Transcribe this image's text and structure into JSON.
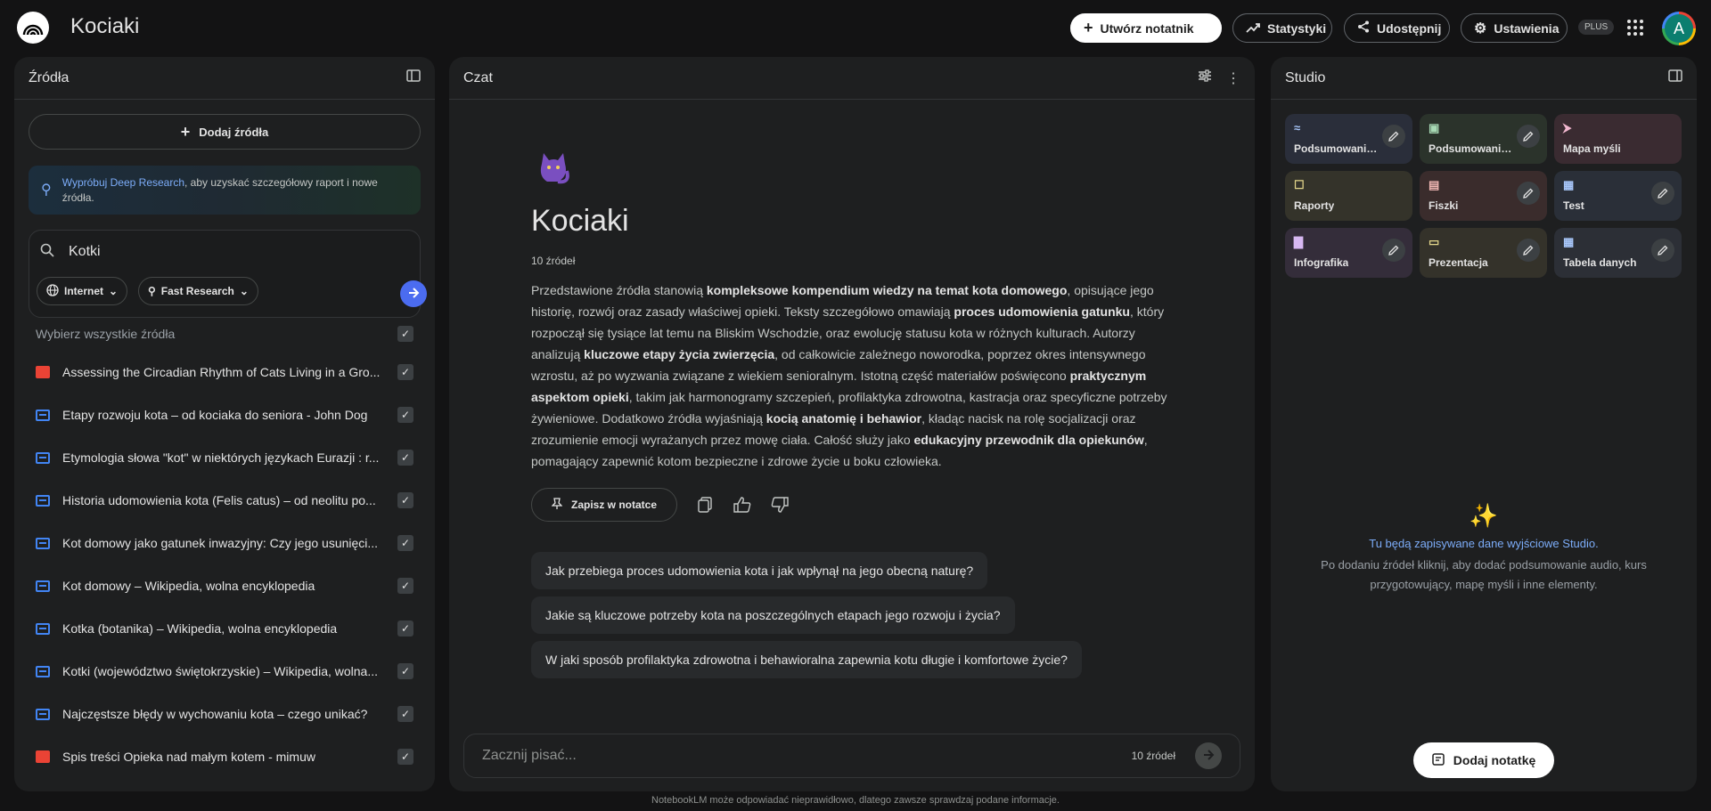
{
  "app": {
    "title": "Kociaki"
  },
  "topbar": {
    "create_notebook": "Utwórz notatnik",
    "statistics": "Statystyki",
    "share": "Udostępnij",
    "settings": "Ustawienia",
    "plan_badge": "PLUS",
    "avatar_letter": "A"
  },
  "sources": {
    "header": "Źródła",
    "add_label": "Dodaj źródła",
    "deep_research": {
      "link": "Wypróbuj Deep Research",
      "text": ", aby uzyskać szczegółowy raport i nowe źródła."
    },
    "search": {
      "value": "Kotki",
      "scope": "Internet",
      "mode": "Fast Research"
    },
    "select_all": "Wybierz wszystkie źródła",
    "items": [
      {
        "type": "pdf",
        "label": "Assessing the Circadian Rhythm of Cats Living in a Gro..."
      },
      {
        "type": "web",
        "label": "Etapy rozwoju kota – od kociaka do seniora - John Dog"
      },
      {
        "type": "web",
        "label": "Etymologia słowa \"kot\" w niektórych językach Eurazji : r..."
      },
      {
        "type": "web",
        "label": "Historia udomowienia kota (Felis catus) – od neolitu po..."
      },
      {
        "type": "web",
        "label": "Kot domowy jako gatunek inwazyjny: Czy jego usunięci..."
      },
      {
        "type": "web",
        "label": "Kot domowy – Wikipedia, wolna encyklopedia"
      },
      {
        "type": "web",
        "label": "Kotka (botanika) – Wikipedia, wolna encyklopedia"
      },
      {
        "type": "web",
        "label": "Kotki (województwo świętokrzyskie) – Wikipedia, wolna..."
      },
      {
        "type": "web",
        "label": "Najczęstsze błędy w wychowaniu kota – czego unikać?"
      },
      {
        "type": "pdf",
        "label": "Spis treści Opieka nad małym kotem - mimuw"
      }
    ]
  },
  "chat": {
    "header": "Czat",
    "notebook_title": "Kociaki",
    "source_count": "10 źródeł",
    "summary_parts": [
      [
        "",
        "Przedstawione źródła stanowią "
      ],
      [
        "b",
        "kompleksowe kompendium wiedzy na temat kota domowego"
      ],
      [
        "",
        ", opisujące jego historię, rozwój oraz zasady właściwej opieki. Teksty szczegółowo omawiają "
      ],
      [
        "b",
        "proces udomowienia gatunku"
      ],
      [
        "",
        ", który rozpoczął się tysiące lat temu na Bliskim Wschodzie, oraz ewolucję statusu kota w różnych kulturach. Autorzy analizują "
      ],
      [
        "b",
        "kluczowe etapy życia zwierzęcia"
      ],
      [
        "",
        ", od całkowicie zależnego noworodka, poprzez okres intensywnego wzrostu, aż po wyzwania związane z wiekiem senioralnym. Istotną część materiałów poświęcono "
      ],
      [
        "b",
        "praktycznym aspektom opieki"
      ],
      [
        "",
        ", takim jak harmonogramy szczepień, profilaktyka zdrowotna, kastracja oraz specyficzne potrzeby żywieniowe. Dodatkowo źródła wyjaśniają "
      ],
      [
        "b",
        "kocią anatomię i behawior"
      ],
      [
        "",
        ", kładąc nacisk na rolę socjalizacji oraz zrozumienie emocji wyrażanych przez mowę ciała. Całość służy jako "
      ],
      [
        "b",
        "edukacyjny przewodnik dla opiekunów"
      ],
      [
        "",
        ", pomagający zapewnić kotom bezpieczne i zdrowe życie u boku człowieka."
      ]
    ],
    "save_note": "Zapisz w notatce",
    "suggestions": [
      "Jak przebiega proces udomowienia kota i jak wpłynął na jego obecną naturę?",
      "Jakie są kluczowe potrzeby kota na poszczególnych etapach jego rozwoju i życia?",
      "W jaki sposób profilaktyka zdrowotna i behawioralna zapewnia kotu długie i komfortowe życie?"
    ],
    "input_placeholder": "Zacznij pisać...",
    "input_count": "10 źródeł"
  },
  "studio": {
    "header": "Studio",
    "tiles": [
      {
        "label": "Podsumowanie audio",
        "bg": "#2a2e3a",
        "icon_color": "#a8c7fa",
        "icon": "≈",
        "edit": true
      },
      {
        "label": "Podsumowanie wideo",
        "bg": "#2b332b",
        "icon_color": "#a8dab5",
        "icon": "▣",
        "edit": true
      },
      {
        "label": "Mapa myśli",
        "bg": "#3a2b31",
        "icon_color": "#f2b8d0",
        "icon": "⮞",
        "edit": false
      },
      {
        "label": "Raporty",
        "bg": "#34332a",
        "icon_color": "#e2d58a",
        "icon": "☐",
        "edit": false
      },
      {
        "label": "Fiszki",
        "bg": "#3a2c2c",
        "icon_color": "#f2b8b5",
        "icon": "▤",
        "edit": true
      },
      {
        "label": "Test",
        "bg": "#2a2f38",
        "icon_color": "#a8c7fa",
        "icon": "▦",
        "edit": true
      },
      {
        "label": "Infografika",
        "bg": "#342d3a",
        "icon_color": "#d7b8f2",
        "icon": "▇",
        "edit": true
      },
      {
        "label": "Prezentacja",
        "bg": "#34322a",
        "icon_color": "#e2d58a",
        "icon": "▭",
        "edit": true
      },
      {
        "label": "Tabela danych",
        "bg": "#2c2f36",
        "icon_color": "#a8c7fa",
        "icon": "▦",
        "edit": true
      }
    ],
    "empty_title": "Tu będą zapisywane dane wyjściowe Studio.",
    "empty_desc": "Po dodaniu źródeł kliknij, aby dodać podsumowanie audio, kurs przygotowujący, mapę myśli i inne elementy.",
    "add_note": "Dodaj notatkę"
  },
  "footer": "NotebookLM może odpowiadać nieprawidłowo, dlatego zawsze sprawdzaj podane informacje."
}
